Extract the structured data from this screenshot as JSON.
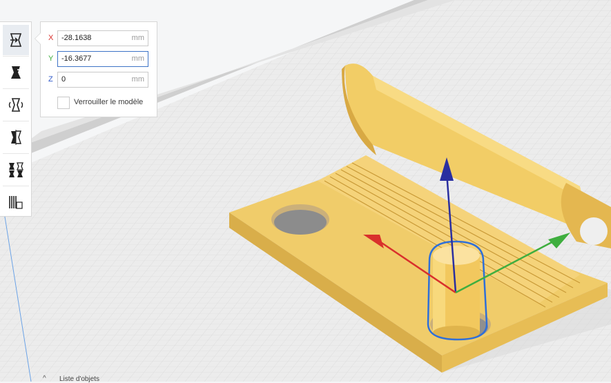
{
  "move_panel": {
    "x": {
      "axis": "X",
      "value": "-28.1638",
      "unit": "mm"
    },
    "y": {
      "axis": "Y",
      "value": "-16.3677",
      "unit": "mm"
    },
    "z": {
      "axis": "Z",
      "value": "0",
      "unit": "mm"
    },
    "lock_label": "Verrouiller le modèle"
  },
  "toolbar": {
    "tools": [
      "move-icon",
      "scale-icon",
      "rotate-icon",
      "mirror-icon",
      "per-model-settings-icon",
      "support-blocker-icon"
    ],
    "active": "move-icon"
  },
  "object_list": {
    "label": "Liste d'objets"
  },
  "colors": {
    "model": "#f3cf6b",
    "axis_x": "#d9302c",
    "axis_y": "#3fae3f",
    "axis_z": "#2a2fa0",
    "selection": "#2f6fd8",
    "build_plate": "#f1f1f1"
  }
}
